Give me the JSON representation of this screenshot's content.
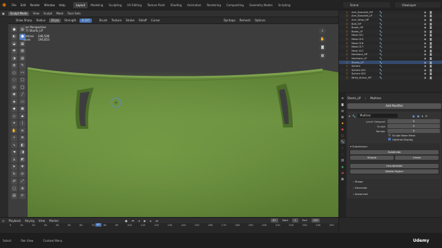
{
  "menubar": {
    "menus": [
      "File",
      "Edit",
      "Render",
      "Window",
      "Help"
    ],
    "workspaces": [
      "Layout",
      "Modeling",
      "Sculpting",
      "UV Editing",
      "Texture Paint",
      "Shading",
      "Animation",
      "Rendering",
      "Compositing",
      "Geometry Nodes",
      "Scripting"
    ],
    "active_workspace": "Layout",
    "scene": "Scene",
    "view_layer": "ViewLayer"
  },
  "viewport_header": {
    "mode": "Sculpt Mode",
    "menus": [
      "View",
      "Sculpt",
      "Mask",
      "Face Sets"
    ],
    "brush_name": "Draw Sharp",
    "radius_label": "Radius",
    "radius_value": "33 px",
    "strength_label": "Strength",
    "strength_value": "0.317",
    "brush_menus": [
      "Brush",
      "Texture",
      "Stroke",
      "Falloff",
      "Cursor"
    ],
    "overlay": "Dyntopo",
    "remesh": "Remesh",
    "options": "Options"
  },
  "hud": {
    "view": "User Perspective",
    "object": "(67) Shorts_LP",
    "vertices_label": "Vertices",
    "vertices_value": "248,508",
    "faces_label": "Faces",
    "faces_value": "194,853"
  },
  "outliner": {
    "items": [
      "Arm_Bracelet_HP",
      "Arm_Bracelet_LP",
      "Arm_Wrap_HP",
      "Belt_HP",
      "Boots_HP",
      "Boots_LP",
      "Mask.001",
      "Mask.010",
      "Mask.016",
      "Mask.017",
      "Mesh.011",
      "Necklace_HP",
      "Necklace_LP",
      "Shorts_LP",
      "Sphere",
      "Sphere.001",
      "Sphere.002",
      "Wrist_Armor_HP"
    ]
  },
  "properties": {
    "object_name": "Shorts_LP",
    "modifier_tab": "Multires",
    "add_modifier": "Add Modifier",
    "modifier_name": "Multires",
    "fields": [
      {
        "label": "Level Viewport",
        "value": "4"
      },
      {
        "label": "Sculpt",
        "value": "4"
      },
      {
        "label": "Render",
        "value": "4"
      }
    ],
    "sculpt_base_mesh": "Sculpt Base Mesh",
    "optimal_display": "Optimal Display",
    "subdivision_title": "Subdivision",
    "subdivide": "Subdivide",
    "simple": "Simple",
    "linear": "Linear",
    "unsubdivide": "Unsubdivide",
    "delete_higher": "Delete Higher",
    "sections": [
      "Shape",
      "Generate",
      "Advanced"
    ]
  },
  "timeline": {
    "menus": [
      "Playback",
      "Keying",
      "View",
      "Marker"
    ],
    "ticks": [
      "0",
      "10",
      "20",
      "30",
      "40",
      "50",
      "60",
      "70",
      "80",
      "90",
      "100",
      "110",
      "120",
      "130",
      "140",
      "150",
      "160",
      "170",
      "180",
      "190",
      "200",
      "210",
      "220",
      "230",
      "240",
      "250"
    ],
    "current_frame": "67",
    "start_label": "Start",
    "start_value": "1",
    "end_label": "End",
    "end_value": "250"
  },
  "statusbar": {
    "items": [
      "Select",
      "Pan View",
      "Context Menu"
    ]
  },
  "watermark": "Udemy",
  "colors": {
    "accent": "#4772b3",
    "mesh": "#6a8c3c",
    "object_icon": "#e8902a"
  }
}
